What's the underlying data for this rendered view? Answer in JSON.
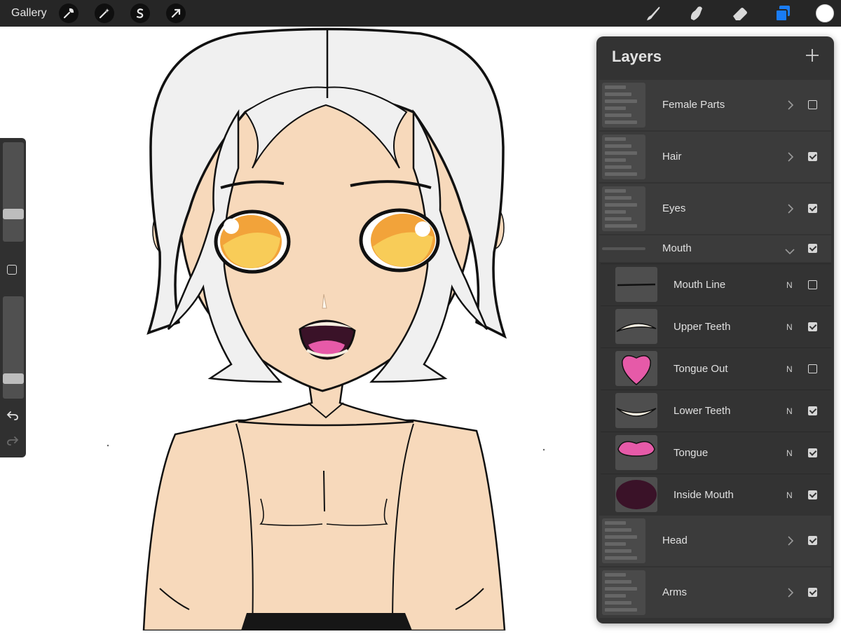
{
  "topbar": {
    "gallery_label": "Gallery",
    "left_tools": [
      "wrench-icon",
      "magic-wand-icon",
      "selection-s-icon",
      "arrow-transform-icon"
    ],
    "right_tools": [
      "brush-icon",
      "smudge-icon",
      "eraser-icon",
      "layers-icon"
    ],
    "active_tool": "layers-icon",
    "color_swatch": "#ffffff",
    "accent": "#1a7cf5"
  },
  "sidebar": {
    "size_slider_value": 0.25,
    "opacity_slider_value": 0.16,
    "undo_icon": "undo-icon",
    "redo_icon": "redo-icon",
    "modify_icon": "square-icon"
  },
  "layers": {
    "title": "Layers",
    "items": [
      {
        "name": "Female Parts",
        "type": "group",
        "expanded": false,
        "visible": false
      },
      {
        "name": "Hair",
        "type": "group",
        "expanded": false,
        "visible": true
      },
      {
        "name": "Eyes",
        "type": "group",
        "expanded": false,
        "visible": true
      },
      {
        "name": "Mouth",
        "type": "group",
        "expanded": true,
        "visible": true
      },
      {
        "name": "Mouth Line",
        "type": "layer",
        "mode": "N",
        "visible": false
      },
      {
        "name": "Upper Teeth",
        "type": "layer",
        "mode": "N",
        "visible": true
      },
      {
        "name": "Tongue Out",
        "type": "layer",
        "mode": "N",
        "visible": false
      },
      {
        "name": "Lower Teeth",
        "type": "layer",
        "mode": "N",
        "visible": true
      },
      {
        "name": "Tongue",
        "type": "layer",
        "mode": "N",
        "visible": true
      },
      {
        "name": "Inside Mouth",
        "type": "layer",
        "mode": "N",
        "visible": true
      },
      {
        "name": "Head",
        "type": "group",
        "expanded": false,
        "visible": true
      },
      {
        "name": "Arms",
        "type": "group",
        "expanded": false,
        "visible": true
      }
    ]
  }
}
